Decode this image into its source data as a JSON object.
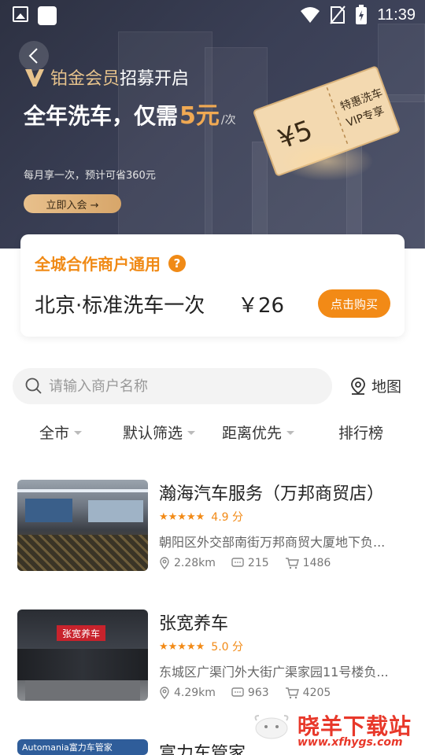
{
  "status_bar": {
    "time": "11:39"
  },
  "hero": {
    "vip_title_gold": "铂金会员",
    "vip_title_rest": "招募开启",
    "main_text": "全年洗车，仅需",
    "main_price": "5元",
    "main_unit": "/次",
    "subtitle": "每月享一次，预计可省360元",
    "join_button": "立即入会 →",
    "ticket": {
      "amount": "¥5",
      "line1": "特惠洗车",
      "line2": "VIP专享"
    }
  },
  "card": {
    "title": "全城合作商户通用",
    "help_icon": "?",
    "product": "北京·标准洗车一次",
    "price": "￥26",
    "buy_button": "点击购买"
  },
  "search": {
    "placeholder": "请输入商户名称",
    "map_label": "地图"
  },
  "filters": [
    {
      "label": "全市",
      "has_caret": true
    },
    {
      "label": "默认筛选",
      "has_caret": true
    },
    {
      "label": "距离优先",
      "has_caret": true
    },
    {
      "label": "排行榜",
      "has_caret": false
    }
  ],
  "shops": [
    {
      "name": "瀚海汽车服务（万邦商贸店）",
      "stars": "★★★★★",
      "score": "4.9 分",
      "address": "朝阳区外交部南街万邦商贸大厦地下负...",
      "distance": "2.28km",
      "comments": "215",
      "orders": "1486"
    },
    {
      "name": "张宽养车",
      "stars": "★★★★★",
      "score": "5.0 分",
      "address": "东城区广渠门外大街广渠家园11号楼负...",
      "distance": "4.29km",
      "comments": "963",
      "orders": "4205",
      "sign_text": "张宽养车"
    },
    {
      "name": "富力车管家",
      "sign_text": "Automania富力车管家"
    }
  ],
  "watermark": {
    "cn": "晓羊下载站",
    "url": "www.xfhygs.com"
  }
}
